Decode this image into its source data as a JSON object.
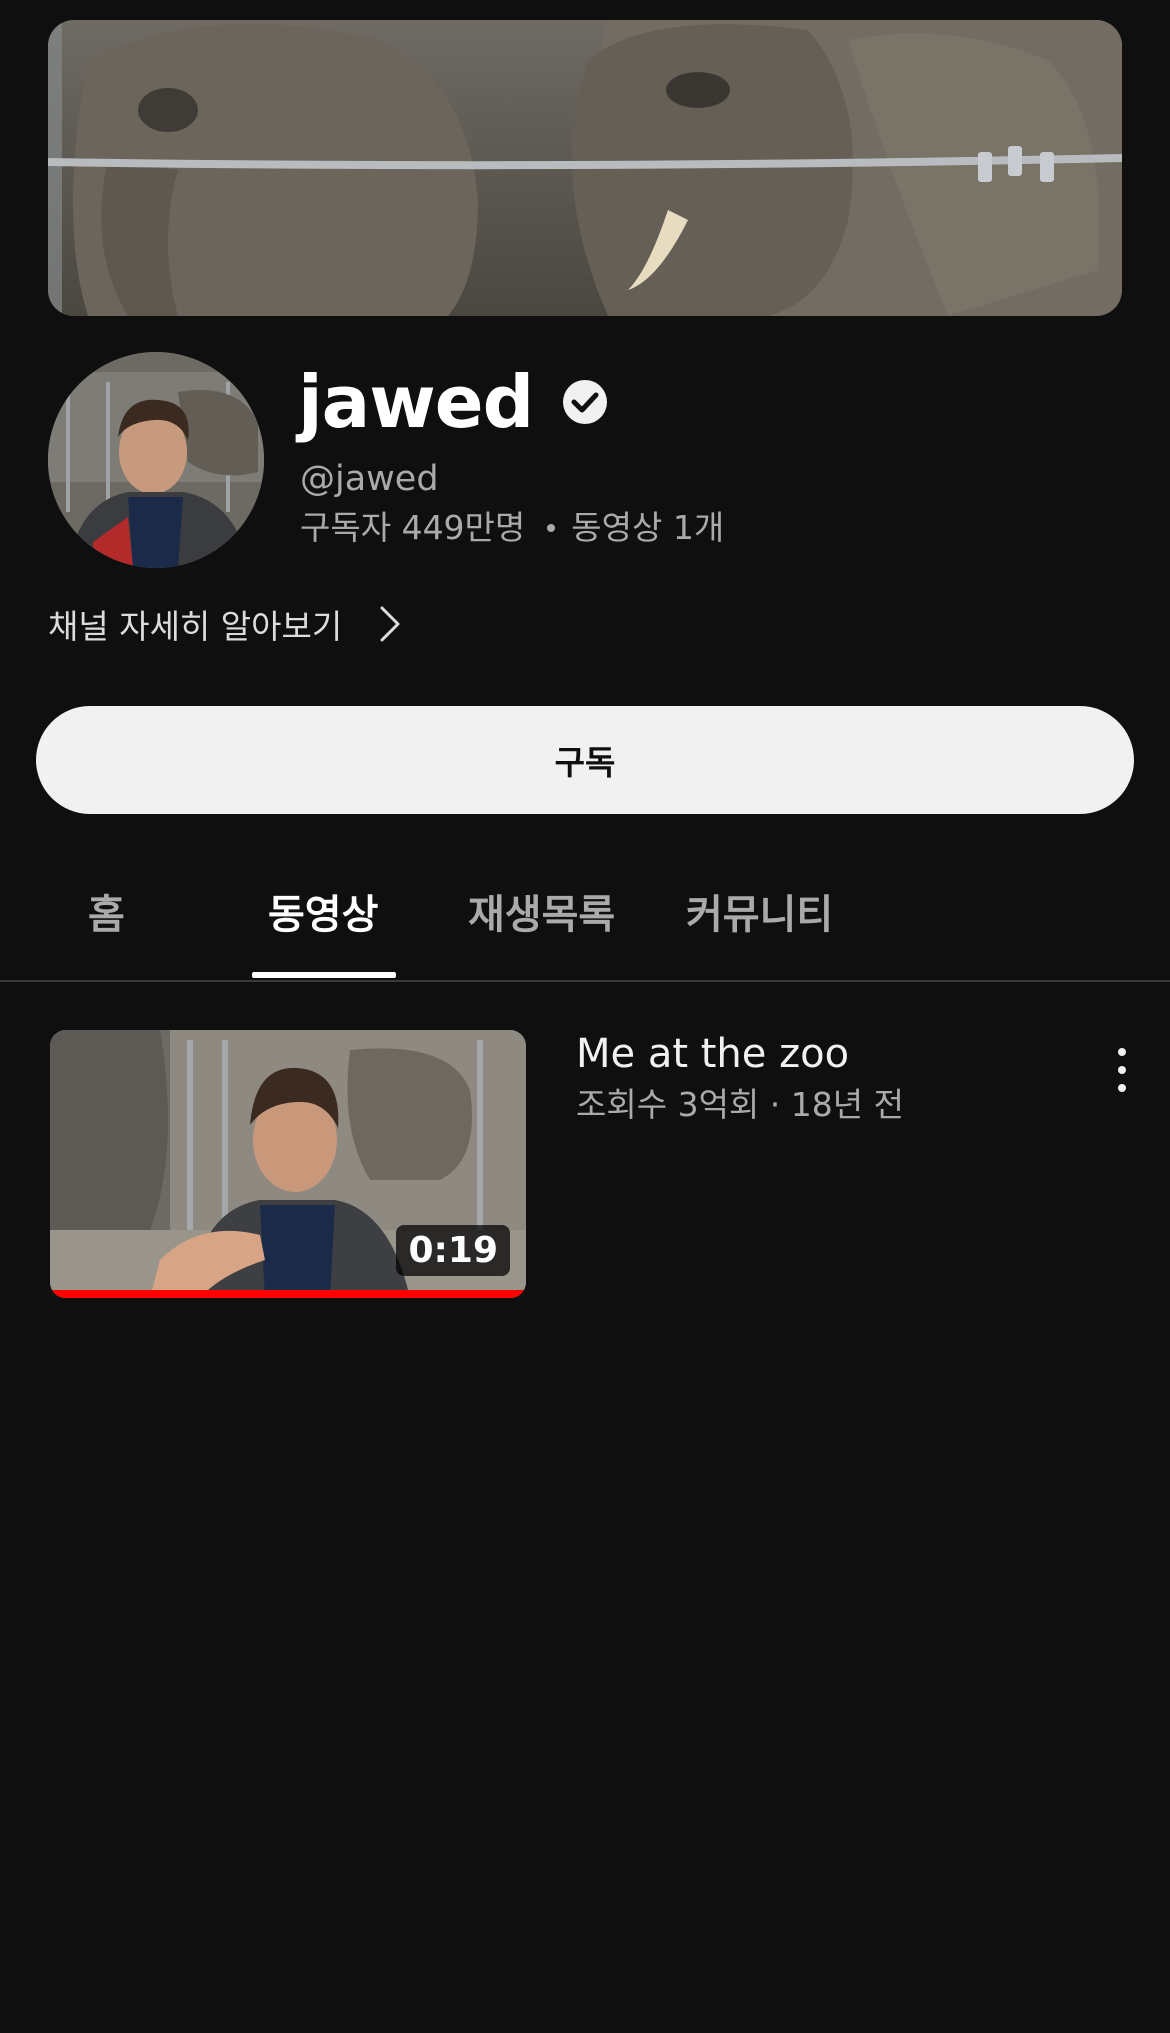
{
  "channel": {
    "name": "jawed",
    "handle": "@jawed",
    "subscribers": "구독자 449만명",
    "video_count": "동영상 1개",
    "about_label": "채널 자세히 알아보기",
    "subscribe_label": "구독",
    "verified_icon": "verified-check-icon"
  },
  "tabs": [
    {
      "label": "홈"
    },
    {
      "label": "동영상",
      "active": true
    },
    {
      "label": "재생목록"
    },
    {
      "label": "커뮤니티"
    }
  ],
  "videos": [
    {
      "title": "Me at the zoo",
      "meta": "조회수 3억회 · 18년 전",
      "duration": "0:19",
      "watched_fraction": 1.0
    }
  ],
  "colors": {
    "background": "#0f0f0f",
    "progress": "#ff0000",
    "subscribe_bg": "#f1f1f1"
  }
}
